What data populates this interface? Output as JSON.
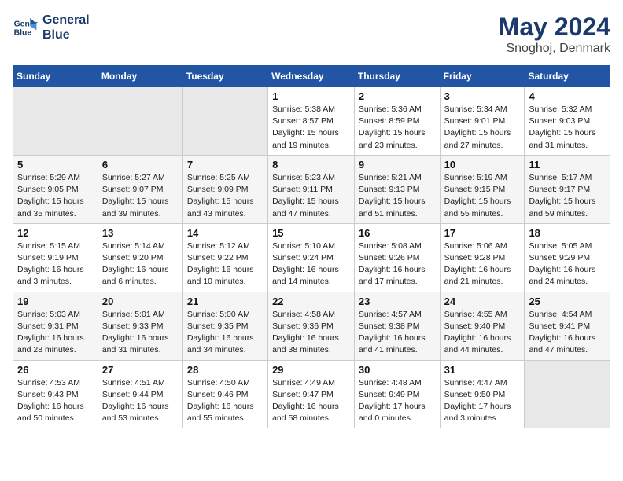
{
  "header": {
    "logo_line1": "General",
    "logo_line2": "Blue",
    "month": "May 2024",
    "location": "Snoghoj, Denmark"
  },
  "weekdays": [
    "Sunday",
    "Monday",
    "Tuesday",
    "Wednesday",
    "Thursday",
    "Friday",
    "Saturday"
  ],
  "weeks": [
    [
      {
        "day": "",
        "info": ""
      },
      {
        "day": "",
        "info": ""
      },
      {
        "day": "",
        "info": ""
      },
      {
        "day": "1",
        "info": "Sunrise: 5:38 AM\nSunset: 8:57 PM\nDaylight: 15 hours\nand 19 minutes."
      },
      {
        "day": "2",
        "info": "Sunrise: 5:36 AM\nSunset: 8:59 PM\nDaylight: 15 hours\nand 23 minutes."
      },
      {
        "day": "3",
        "info": "Sunrise: 5:34 AM\nSunset: 9:01 PM\nDaylight: 15 hours\nand 27 minutes."
      },
      {
        "day": "4",
        "info": "Sunrise: 5:32 AM\nSunset: 9:03 PM\nDaylight: 15 hours\nand 31 minutes."
      }
    ],
    [
      {
        "day": "5",
        "info": "Sunrise: 5:29 AM\nSunset: 9:05 PM\nDaylight: 15 hours\nand 35 minutes."
      },
      {
        "day": "6",
        "info": "Sunrise: 5:27 AM\nSunset: 9:07 PM\nDaylight: 15 hours\nand 39 minutes."
      },
      {
        "day": "7",
        "info": "Sunrise: 5:25 AM\nSunset: 9:09 PM\nDaylight: 15 hours\nand 43 minutes."
      },
      {
        "day": "8",
        "info": "Sunrise: 5:23 AM\nSunset: 9:11 PM\nDaylight: 15 hours\nand 47 minutes."
      },
      {
        "day": "9",
        "info": "Sunrise: 5:21 AM\nSunset: 9:13 PM\nDaylight: 15 hours\nand 51 minutes."
      },
      {
        "day": "10",
        "info": "Sunrise: 5:19 AM\nSunset: 9:15 PM\nDaylight: 15 hours\nand 55 minutes."
      },
      {
        "day": "11",
        "info": "Sunrise: 5:17 AM\nSunset: 9:17 PM\nDaylight: 15 hours\nand 59 minutes."
      }
    ],
    [
      {
        "day": "12",
        "info": "Sunrise: 5:15 AM\nSunset: 9:19 PM\nDaylight: 16 hours\nand 3 minutes."
      },
      {
        "day": "13",
        "info": "Sunrise: 5:14 AM\nSunset: 9:20 PM\nDaylight: 16 hours\nand 6 minutes."
      },
      {
        "day": "14",
        "info": "Sunrise: 5:12 AM\nSunset: 9:22 PM\nDaylight: 16 hours\nand 10 minutes."
      },
      {
        "day": "15",
        "info": "Sunrise: 5:10 AM\nSunset: 9:24 PM\nDaylight: 16 hours\nand 14 minutes."
      },
      {
        "day": "16",
        "info": "Sunrise: 5:08 AM\nSunset: 9:26 PM\nDaylight: 16 hours\nand 17 minutes."
      },
      {
        "day": "17",
        "info": "Sunrise: 5:06 AM\nSunset: 9:28 PM\nDaylight: 16 hours\nand 21 minutes."
      },
      {
        "day": "18",
        "info": "Sunrise: 5:05 AM\nSunset: 9:29 PM\nDaylight: 16 hours\nand 24 minutes."
      }
    ],
    [
      {
        "day": "19",
        "info": "Sunrise: 5:03 AM\nSunset: 9:31 PM\nDaylight: 16 hours\nand 28 minutes."
      },
      {
        "day": "20",
        "info": "Sunrise: 5:01 AM\nSunset: 9:33 PM\nDaylight: 16 hours\nand 31 minutes."
      },
      {
        "day": "21",
        "info": "Sunrise: 5:00 AM\nSunset: 9:35 PM\nDaylight: 16 hours\nand 34 minutes."
      },
      {
        "day": "22",
        "info": "Sunrise: 4:58 AM\nSunset: 9:36 PM\nDaylight: 16 hours\nand 38 minutes."
      },
      {
        "day": "23",
        "info": "Sunrise: 4:57 AM\nSunset: 9:38 PM\nDaylight: 16 hours\nand 41 minutes."
      },
      {
        "day": "24",
        "info": "Sunrise: 4:55 AM\nSunset: 9:40 PM\nDaylight: 16 hours\nand 44 minutes."
      },
      {
        "day": "25",
        "info": "Sunrise: 4:54 AM\nSunset: 9:41 PM\nDaylight: 16 hours\nand 47 minutes."
      }
    ],
    [
      {
        "day": "26",
        "info": "Sunrise: 4:53 AM\nSunset: 9:43 PM\nDaylight: 16 hours\nand 50 minutes."
      },
      {
        "day": "27",
        "info": "Sunrise: 4:51 AM\nSunset: 9:44 PM\nDaylight: 16 hours\nand 53 minutes."
      },
      {
        "day": "28",
        "info": "Sunrise: 4:50 AM\nSunset: 9:46 PM\nDaylight: 16 hours\nand 55 minutes."
      },
      {
        "day": "29",
        "info": "Sunrise: 4:49 AM\nSunset: 9:47 PM\nDaylight: 16 hours\nand 58 minutes."
      },
      {
        "day": "30",
        "info": "Sunrise: 4:48 AM\nSunset: 9:49 PM\nDaylight: 17 hours\nand 0 minutes."
      },
      {
        "day": "31",
        "info": "Sunrise: 4:47 AM\nSunset: 9:50 PM\nDaylight: 17 hours\nand 3 minutes."
      },
      {
        "day": "",
        "info": ""
      }
    ]
  ]
}
